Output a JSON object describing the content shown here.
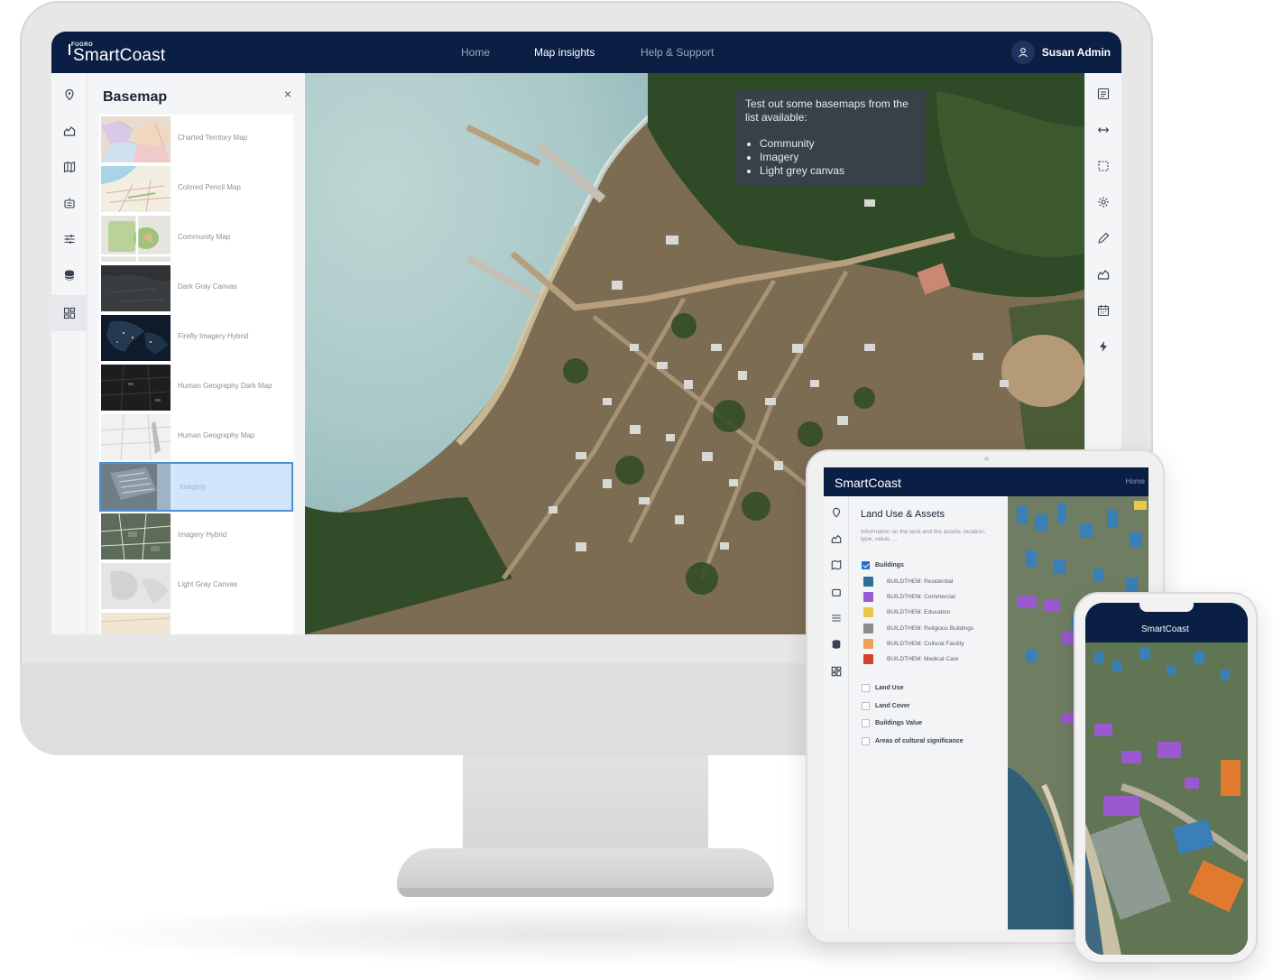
{
  "desktop": {
    "brand": {
      "company": "FUGRO",
      "product": "SmartCoast"
    },
    "nav": {
      "home": "Home",
      "map_insights": "Map insights",
      "help": "Help & Support"
    },
    "user": {
      "name": "Susan Admin"
    },
    "basemap_panel": {
      "title": "Basemap",
      "close": "×",
      "items": [
        {
          "label": "Charted Territory Map"
        },
        {
          "label": "Colored Pencil Map"
        },
        {
          "label": "Community Map"
        },
        {
          "label": "Dark Gray Canvas"
        },
        {
          "label": "Firefly Imagery Hybrid"
        },
        {
          "label": "Human Geography Dark Map"
        },
        {
          "label": "Human Geography Map"
        },
        {
          "label": "Imagery",
          "selected": true
        },
        {
          "label": "Imagery Hybrid"
        },
        {
          "label": "Light Gray Canvas"
        }
      ]
    },
    "tooltip": {
      "intro": "Test out some basemaps from the list available:",
      "items": [
        "Community",
        "Imagery",
        "Light grey canvas"
      ]
    },
    "left_rail_icons": [
      "location-pin-icon",
      "landscape-icon",
      "map-icon",
      "robot-icon",
      "sliders-icon",
      "database-icon",
      "grid-icon"
    ],
    "right_rail_icons": [
      "legend-icon",
      "measure-icon",
      "select-area-icon",
      "settings-icon",
      "pencil-icon",
      "landscape-icon",
      "calendar-icon",
      "lightning-icon"
    ]
  },
  "tablet": {
    "brand": "SmartCoast",
    "nav_home": "Home",
    "panel_title": "Land Use & Assets",
    "panel_desc": "Information on the land and the assets: location, type, value, ...",
    "buildings_label": "Buildings",
    "legend": [
      {
        "label": "BUILDTHEM: Residential",
        "color": "#2f6f93"
      },
      {
        "label": "BUILDTHEM: Commercial",
        "color": "#9b59d0"
      },
      {
        "label": "BUILDTHEM: Education",
        "color": "#e6c84a"
      },
      {
        "label": "BUILDTHEM: Religious Buildings",
        "color": "#8c8c8c"
      },
      {
        "label": "BUILDTHEM: Cultural Facility",
        "color": "#f0a058"
      },
      {
        "label": "BUILDTHEM: Medical Care",
        "color": "#d2402f"
      }
    ],
    "layers": [
      "Land Use",
      "Land Cover",
      "Buildings Value",
      "Areas of cultural significance"
    ]
  },
  "phone": {
    "brand": "SmartCoast"
  },
  "colors": {
    "navy": "#0b1f44",
    "selected_bg": "#cfe6fb",
    "selected_border": "#4f8fd6",
    "check_blue": "#1f6fd0"
  }
}
